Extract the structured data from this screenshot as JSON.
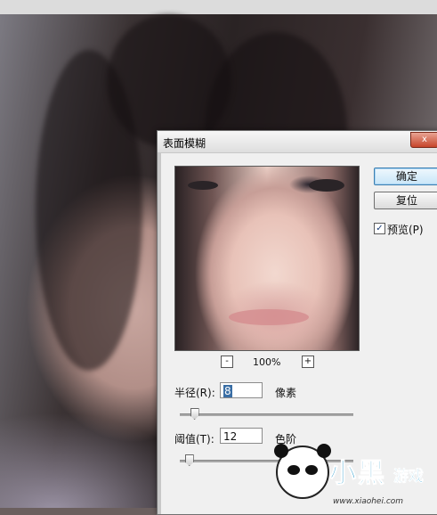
{
  "dialog": {
    "title": "表面模糊",
    "close_label": "x",
    "ok_label": "确定",
    "reset_label": "复位",
    "preview_checkbox": {
      "label": "预览(P)",
      "checked": true,
      "mark": "✓"
    },
    "zoom": {
      "minus": "-",
      "plus": "+",
      "level": "100%"
    },
    "radius": {
      "label": "半径(R):",
      "value": "8",
      "unit": "像素",
      "slider_fraction": 0.08
    },
    "threshold": {
      "label": "阈值(T):",
      "value": "12",
      "unit": "色阶",
      "slider_fraction": 0.05
    }
  },
  "watermark": {
    "big_text": "小黑",
    "small_text": "游戏",
    "url": "www.xiaohei.com"
  },
  "colors": {
    "dialog_bg": "#f0f0f0",
    "selection": "#3a6ea5",
    "default_button_border": "#3c7fb1",
    "close_button": "#c7452b",
    "logo_blue": "#0f8ec6"
  }
}
